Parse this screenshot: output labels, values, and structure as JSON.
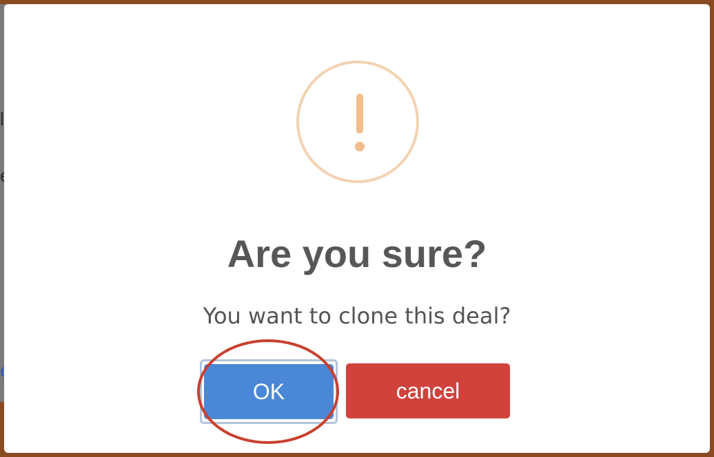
{
  "background": {
    "fragments": [
      "l",
      "e",
      "e"
    ]
  },
  "dialog": {
    "icon": "warning-exclamation-icon",
    "title": "Are you sure?",
    "message": "You want to clone this deal?",
    "ok_label": "OK",
    "cancel_label": "cancel"
  },
  "colors": {
    "ok_button": "#4a87d6",
    "cancel_button": "#cf433c",
    "warning_icon": "#f1bd8d",
    "annotation_ring": "#c9402f"
  },
  "annotation": {
    "shape": "ellipse",
    "target": "ok-button"
  }
}
